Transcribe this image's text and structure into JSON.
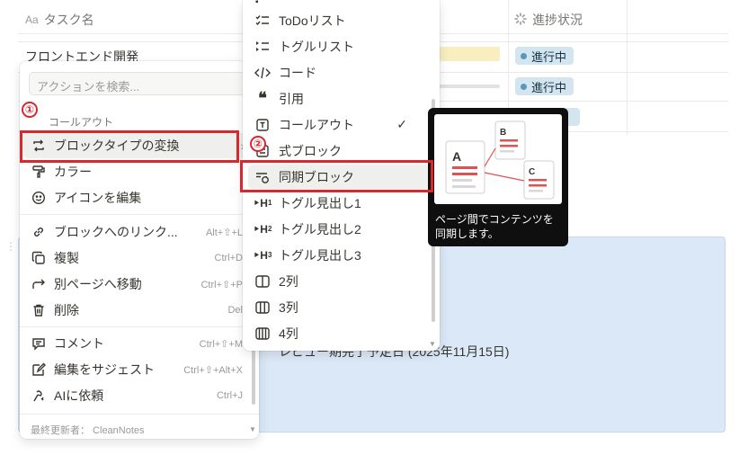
{
  "table": {
    "col_name_prefix": "Aa",
    "col_name": "タスク名",
    "col_status": "進捗状況",
    "row_name": "フロントエンド開発",
    "status_badges": [
      "進行中",
      "進行中"
    ]
  },
  "callout_text": "レビュー期完了予定日 (2025年11月15日)",
  "menu": {
    "search_placeholder": "アクションを検索...",
    "section_label": "コールアウト",
    "items": [
      {
        "label": "ブロックタイプの変換",
        "shortcut": "",
        "icon": "convert-icon"
      },
      {
        "label": "カラー",
        "shortcut": "",
        "icon": "paint-roller-icon"
      },
      {
        "label": "アイコンを編集",
        "shortcut": "",
        "icon": "smiley-icon"
      },
      {
        "label": "ブロックへのリンク...",
        "shortcut": "Alt+⇧+L",
        "icon": "link-icon"
      },
      {
        "label": "複製",
        "shortcut": "Ctrl+D",
        "icon": "duplicate-icon"
      },
      {
        "label": "別ページへ移動",
        "shortcut": "Ctrl+⇧+P",
        "icon": "move-arrow-icon"
      },
      {
        "label": "削除",
        "shortcut": "Del",
        "icon": "trash-icon"
      },
      {
        "label": "コメント",
        "shortcut": "Ctrl+⇧+M",
        "icon": "comment-icon"
      },
      {
        "label": "編集をサジェスト",
        "shortcut": "Ctrl+⇧+Alt+X",
        "icon": "suggest-edit-icon"
      },
      {
        "label": "AIに依頼",
        "shortcut": "Ctrl+J",
        "icon": "ai-icon"
      }
    ],
    "footer": "最終更新者： CleanNotes"
  },
  "submenu": {
    "items": [
      {
        "label": "ToDoリスト",
        "icon": "todo-list-icon"
      },
      {
        "label": "トグルリスト",
        "icon": "toggle-list-icon"
      },
      {
        "label": "コード",
        "icon": "code-icon"
      },
      {
        "label": "引用",
        "icon": "quote-icon"
      },
      {
        "label": "コールアウト",
        "icon": "callout-icon"
      },
      {
        "label": "式ブロック",
        "icon": "equation-icon"
      },
      {
        "label": "同期ブロック",
        "icon": "sync-block-icon"
      },
      {
        "label": "トグル見出し1",
        "icon": "toggle-h1-icon"
      },
      {
        "label": "トグル見出し2",
        "icon": "toggle-h2-icon"
      },
      {
        "label": "トグル見出し3",
        "icon": "toggle-h3-icon"
      },
      {
        "label": "2列",
        "icon": "columns-2-icon"
      },
      {
        "label": "3列",
        "icon": "columns-3-icon"
      },
      {
        "label": "4列",
        "icon": "columns-4-icon"
      }
    ],
    "checked_label": "✓"
  },
  "tooltip": {
    "text": "ページ間でコンテンツを同期します。",
    "preview_letters": [
      "A",
      "B",
      "C"
    ]
  },
  "annotations": {
    "marker1": "①",
    "marker2": "②",
    "color": "#d9272e"
  }
}
